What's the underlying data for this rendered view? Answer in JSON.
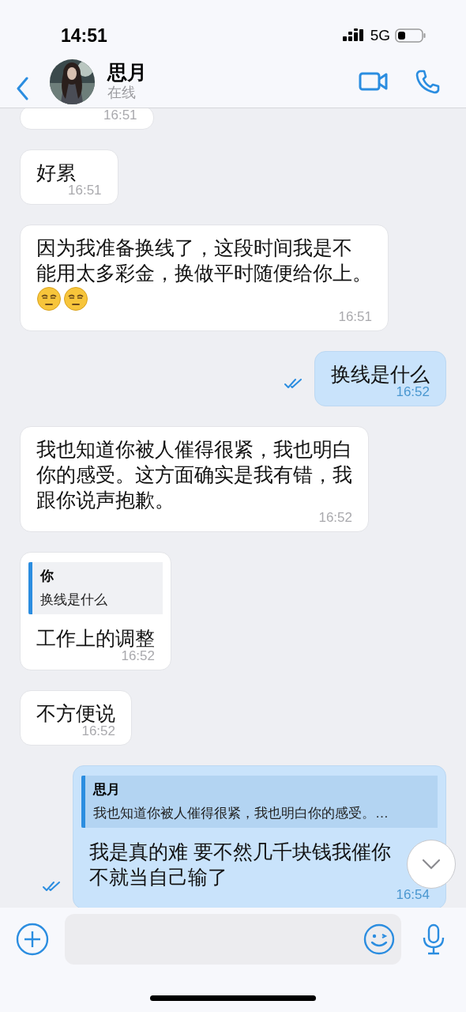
{
  "status_bar": {
    "time": "14:51",
    "network": "5G"
  },
  "header": {
    "name": "思月",
    "status": "在线"
  },
  "messages": [
    {
      "outgoing": false,
      "kind": "time_only",
      "time": "16:51"
    },
    {
      "outgoing": false,
      "kind": "text",
      "lines": [
        "好累"
      ],
      "time": "16:51"
    },
    {
      "outgoing": false,
      "kind": "text_emoji",
      "lines": [
        "因为我准备换线了，这段时间我是不",
        "能用太多彩金，换做平时随便给你上。"
      ],
      "time": "16:51"
    },
    {
      "outgoing": true,
      "kind": "text",
      "lines": [
        "换线是什么"
      ],
      "time": "16:52",
      "read": true
    },
    {
      "outgoing": false,
      "kind": "text",
      "lines": [
        "我也知道你被人催得很紧，我也明白",
        "你的感受。这方面确实是我有错，我",
        "跟你说声抱歉。"
      ],
      "time": "16:52"
    },
    {
      "outgoing": false,
      "kind": "reply",
      "reply": {
        "author": "你",
        "text": "换线是什么"
      },
      "lines": [
        "工作上的调整"
      ],
      "time": "16:52"
    },
    {
      "outgoing": false,
      "kind": "text",
      "lines": [
        "不方便说"
      ],
      "time": "16:52"
    },
    {
      "outgoing": true,
      "kind": "reply",
      "reply": {
        "author": "思月",
        "text": "我也知道你被人催得很紧，我也明白你的感受。…"
      },
      "lines": [
        "我是真的难 要不然几千块钱我催你",
        "不就当自己输了"
      ],
      "time": "16:54",
      "read": true
    }
  ]
}
